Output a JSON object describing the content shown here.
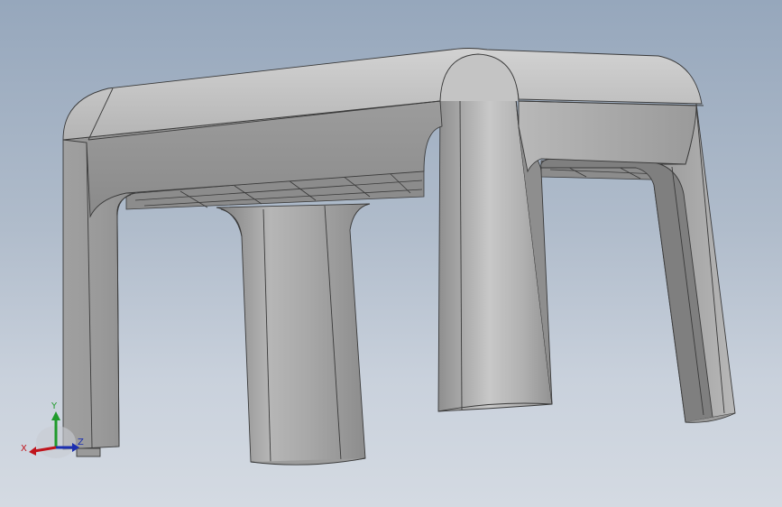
{
  "viewport": {
    "background_top": "#96a7bc",
    "background_bottom": "#d4dae2",
    "model_color": "#a9a9a9",
    "edge_color": "#3a3a3a"
  },
  "triad": {
    "x_label": "X",
    "y_label": "Y",
    "z_label": "Z",
    "x_color": "#c0141c",
    "y_color": "#1f9a2b",
    "z_color": "#1b2fb0"
  }
}
